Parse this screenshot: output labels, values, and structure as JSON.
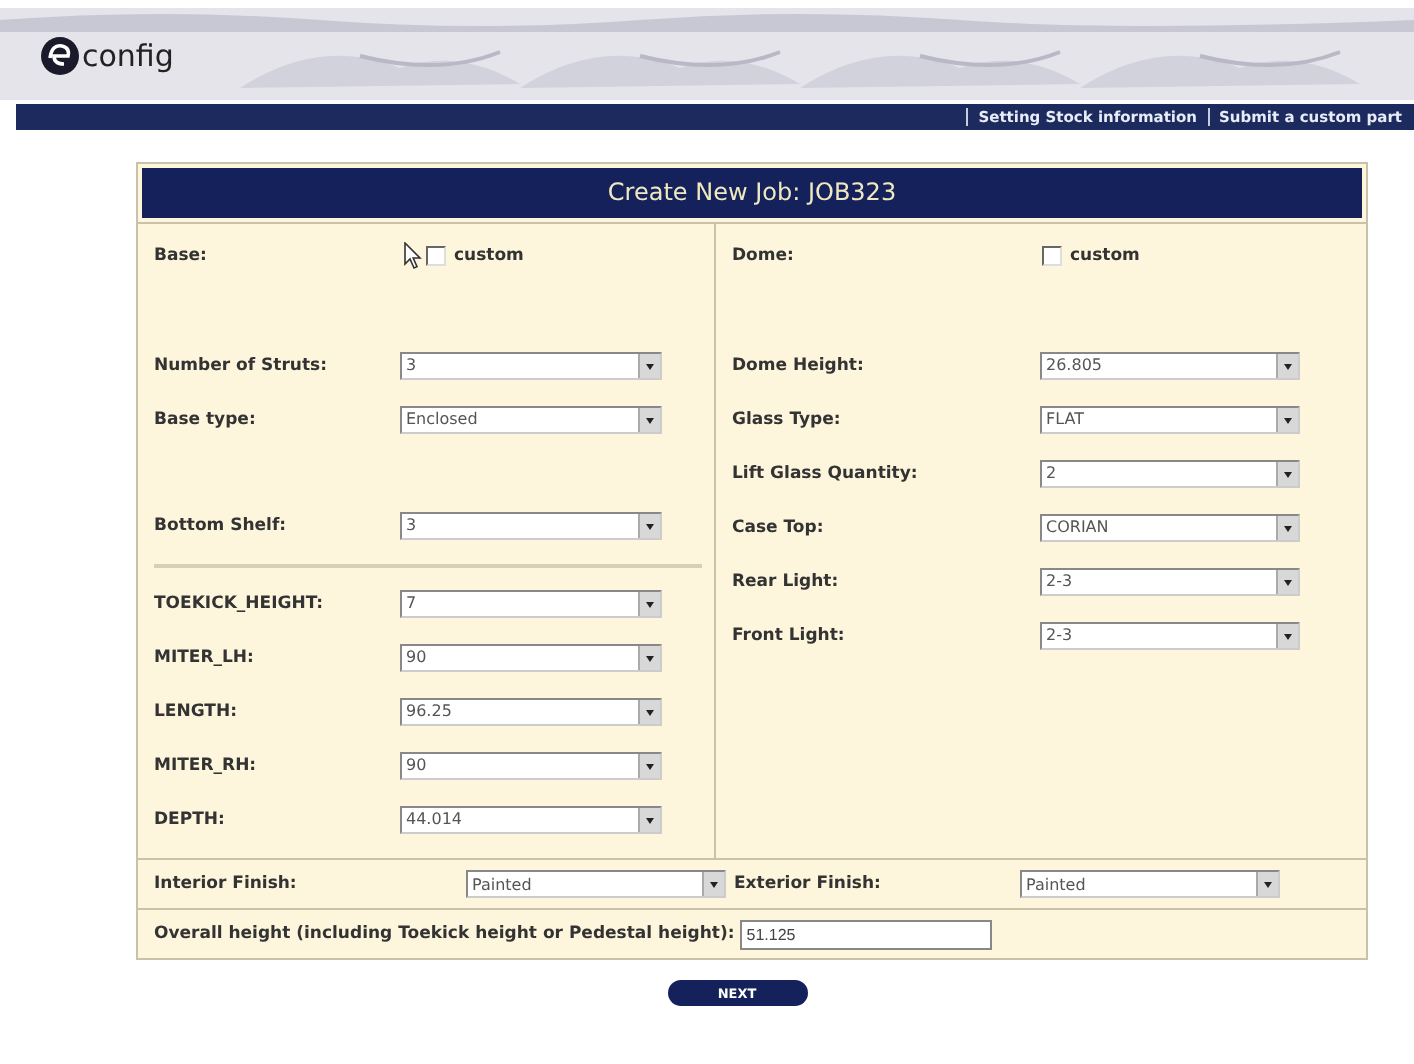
{
  "header": {
    "logo_text": "config",
    "nav_links": [
      {
        "label": "Setting Stock information"
      },
      {
        "label": "Submit a custom part"
      }
    ]
  },
  "form": {
    "title": "Create New Job: JOB323",
    "left": {
      "label": "Base:",
      "custom": {
        "label": "custom",
        "checked": false
      },
      "groups": [
        {
          "divider_before": false,
          "fields": [
            {
              "label": "Number of Struts:",
              "value": "3"
            },
            {
              "label": "Base type:",
              "value": "Enclosed"
            }
          ]
        },
        {
          "divider_before": false,
          "fields": [
            {
              "label": "Bottom Shelf:",
              "value": "3"
            }
          ]
        },
        {
          "divider_before": true,
          "fields": [
            {
              "label": "TOEKICK_HEIGHT:",
              "value": "7"
            },
            {
              "label": "MITER_LH:",
              "value": "90"
            },
            {
              "label": "LENGTH:",
              "value": "96.25"
            },
            {
              "label": "MITER_RH:",
              "value": "90"
            },
            {
              "label": "DEPTH:",
              "value": "44.014"
            }
          ]
        }
      ]
    },
    "right": {
      "label": "Dome:",
      "custom": {
        "label": "custom",
        "checked": false
      },
      "groups": [
        {
          "divider_before": false,
          "fields": [
            {
              "label": "Dome Height:",
              "value": "26.805"
            },
            {
              "label": "Glass Type:",
              "value": "FLAT"
            },
            {
              "label": "Lift Glass Quantity:",
              "value": "2"
            },
            {
              "label": "Case Top:",
              "value": "CORIAN"
            },
            {
              "label": "Rear Light:",
              "value": "2-3"
            },
            {
              "label": "Front Light:",
              "value": "2-3"
            }
          ]
        }
      ]
    },
    "finishes": [
      {
        "label": "Interior Finish:",
        "value": "Painted"
      },
      {
        "label": "Exterior Finish:",
        "value": "Painted"
      }
    ],
    "overall": {
      "label": "Overall height (including Toekick height or Pedestal height):",
      "value": "51.125"
    },
    "next_button": "NEXT"
  }
}
